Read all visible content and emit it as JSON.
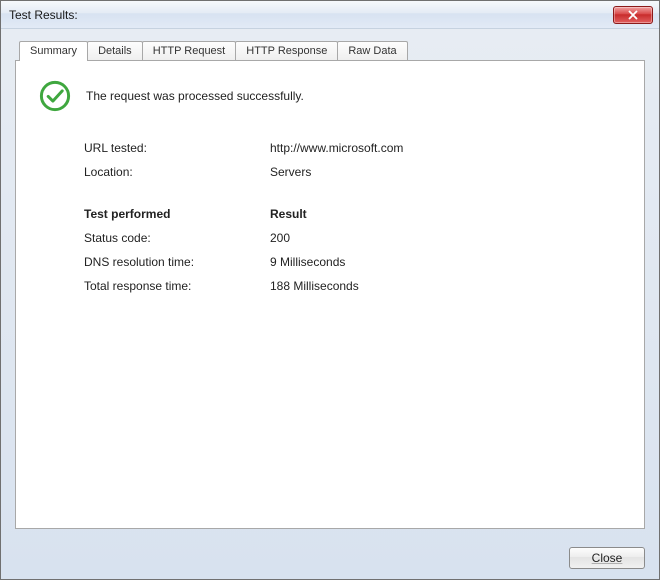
{
  "window": {
    "title": "Test Results:"
  },
  "tabs": {
    "summary": "Summary",
    "details": "Details",
    "http_request": "HTTP Request",
    "http_response": "HTTP Response",
    "raw_data": "Raw Data"
  },
  "status": {
    "message": "The request was processed successfully."
  },
  "info": {
    "url_tested_label": "URL tested:",
    "url_tested_value": "http://www.microsoft.com",
    "location_label": "Location:",
    "location_value": "Servers"
  },
  "results": {
    "header_test": "Test performed",
    "header_result": "Result",
    "status_code_label": "Status code:",
    "status_code_value": "200",
    "dns_label": "DNS resolution time:",
    "dns_value": "9 Milliseconds",
    "total_label": "Total response time:",
    "total_value": "188 Milliseconds"
  },
  "footer": {
    "close_label": "Close"
  }
}
